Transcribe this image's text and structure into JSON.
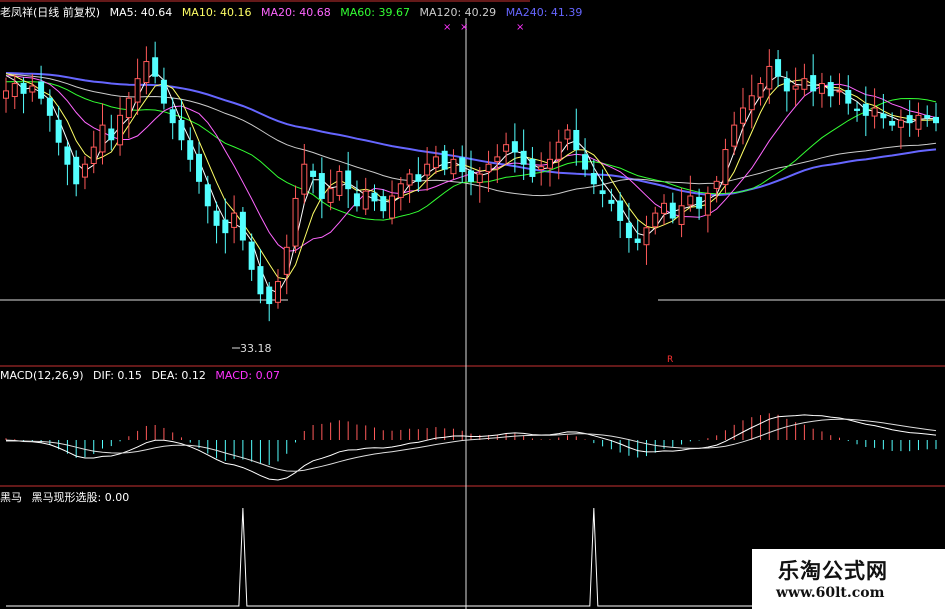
{
  "price_panel": {
    "header": {
      "name": "老凤祥(日线 前复权)",
      "ma5": "MA5: 40.64",
      "ma10": "MA10: 40.16",
      "ma20": "MA20: 40.68",
      "ma60": "MA60: 39.67",
      "ma120": "MA120: 40.29",
      "ma240": "MA240: 41.39"
    },
    "low_label": "33.18"
  },
  "macd_panel": {
    "header": {
      "name": "MACD(12,26,9)",
      "dif": "DIF: 0.15",
      "dea": "DEA: 0.12",
      "macd": "MACD: 0.07"
    }
  },
  "signal_panel": {
    "header": {
      "name": "黑马",
      "indicator": "黑马现形选股: 0.00"
    }
  },
  "watermark": {
    "brand": "乐淘公式网",
    "url": "www.60lt.com"
  },
  "colors": {
    "bg": "#000000",
    "up_candle": "#ff5a5a",
    "down_candle": "#54ffff",
    "ma5": "#ffffff",
    "ma10": "#ffff66",
    "ma20": "#ff66ff",
    "ma60": "#33ff33",
    "ma120": "#cccccc",
    "ma240": "#6666ff",
    "macd_label": "#ff33ff",
    "separator": "#c83232"
  },
  "chart_data": [
    {
      "type": "candlestick",
      "title": "老凤祥(日线 前复权)",
      "ylim": [
        32.0,
        45.5
      ],
      "price_min_label": 33.18,
      "closes": [
        42.6,
        42.9,
        42.5,
        42.8,
        42.3,
        41.6,
        40.5,
        39.6,
        38.8,
        39.6,
        40.3,
        41.2,
        40.6,
        41.6,
        42.3,
        43.1,
        43.8,
        43.2,
        42.1,
        41.3,
        40.6,
        39.8,
        38.9,
        37.9,
        37.1,
        36.8,
        37.6,
        36.5,
        35.3,
        34.3,
        33.9,
        34.8,
        36.2,
        38.2,
        39.6,
        39.1,
        38.2,
        38.6,
        39.3,
        38.6,
        37.9,
        38.5,
        38.1,
        37.7,
        38.3,
        38.8,
        39.2,
        38.9,
        39.6,
        39.9,
        39.4,
        39.8,
        39.3,
        38.9,
        39.2,
        39.6,
        39.9,
        40.4,
        40.1,
        39.6,
        39.1,
        39.5,
        39.8,
        40.5,
        41.0,
        40.2,
        39.4,
        38.8,
        38.4,
        38.0,
        37.3,
        36.6,
        36.4,
        37.0,
        37.6,
        38.0,
        37.4,
        37.9,
        38.3,
        37.8,
        38.4,
        38.9,
        40.2,
        41.2,
        41.9,
        42.4,
        42.9,
        43.6,
        43.2,
        42.6,
        42.8,
        43.1,
        42.6,
        42.9,
        42.4,
        42.6,
        42.1,
        41.8,
        41.6,
        41.9,
        41.5,
        41.2,
        41.4,
        41.3,
        41.6,
        41.5,
        41.3
      ],
      "series": [
        {
          "name": "MA5",
          "value": 40.64
        },
        {
          "name": "MA10",
          "value": 40.16
        },
        {
          "name": "MA20",
          "value": 40.68
        },
        {
          "name": "MA60",
          "value": 39.67
        },
        {
          "name": "MA120",
          "value": 40.29
        },
        {
          "name": "MA240",
          "value": 41.39
        }
      ]
    },
    {
      "type": "bar",
      "title": "MACD(12,26,9)",
      "series": [
        {
          "name": "DIF",
          "value": 0.15
        },
        {
          "name": "DEA",
          "value": 0.12
        },
        {
          "name": "MACD",
          "value": 0.07
        }
      ]
    },
    {
      "type": "line",
      "title": "黑马",
      "series": [
        {
          "name": "黑马现形选股",
          "value": 0.0,
          "spike_bars": [
            27,
            67
          ]
        }
      ]
    }
  ]
}
